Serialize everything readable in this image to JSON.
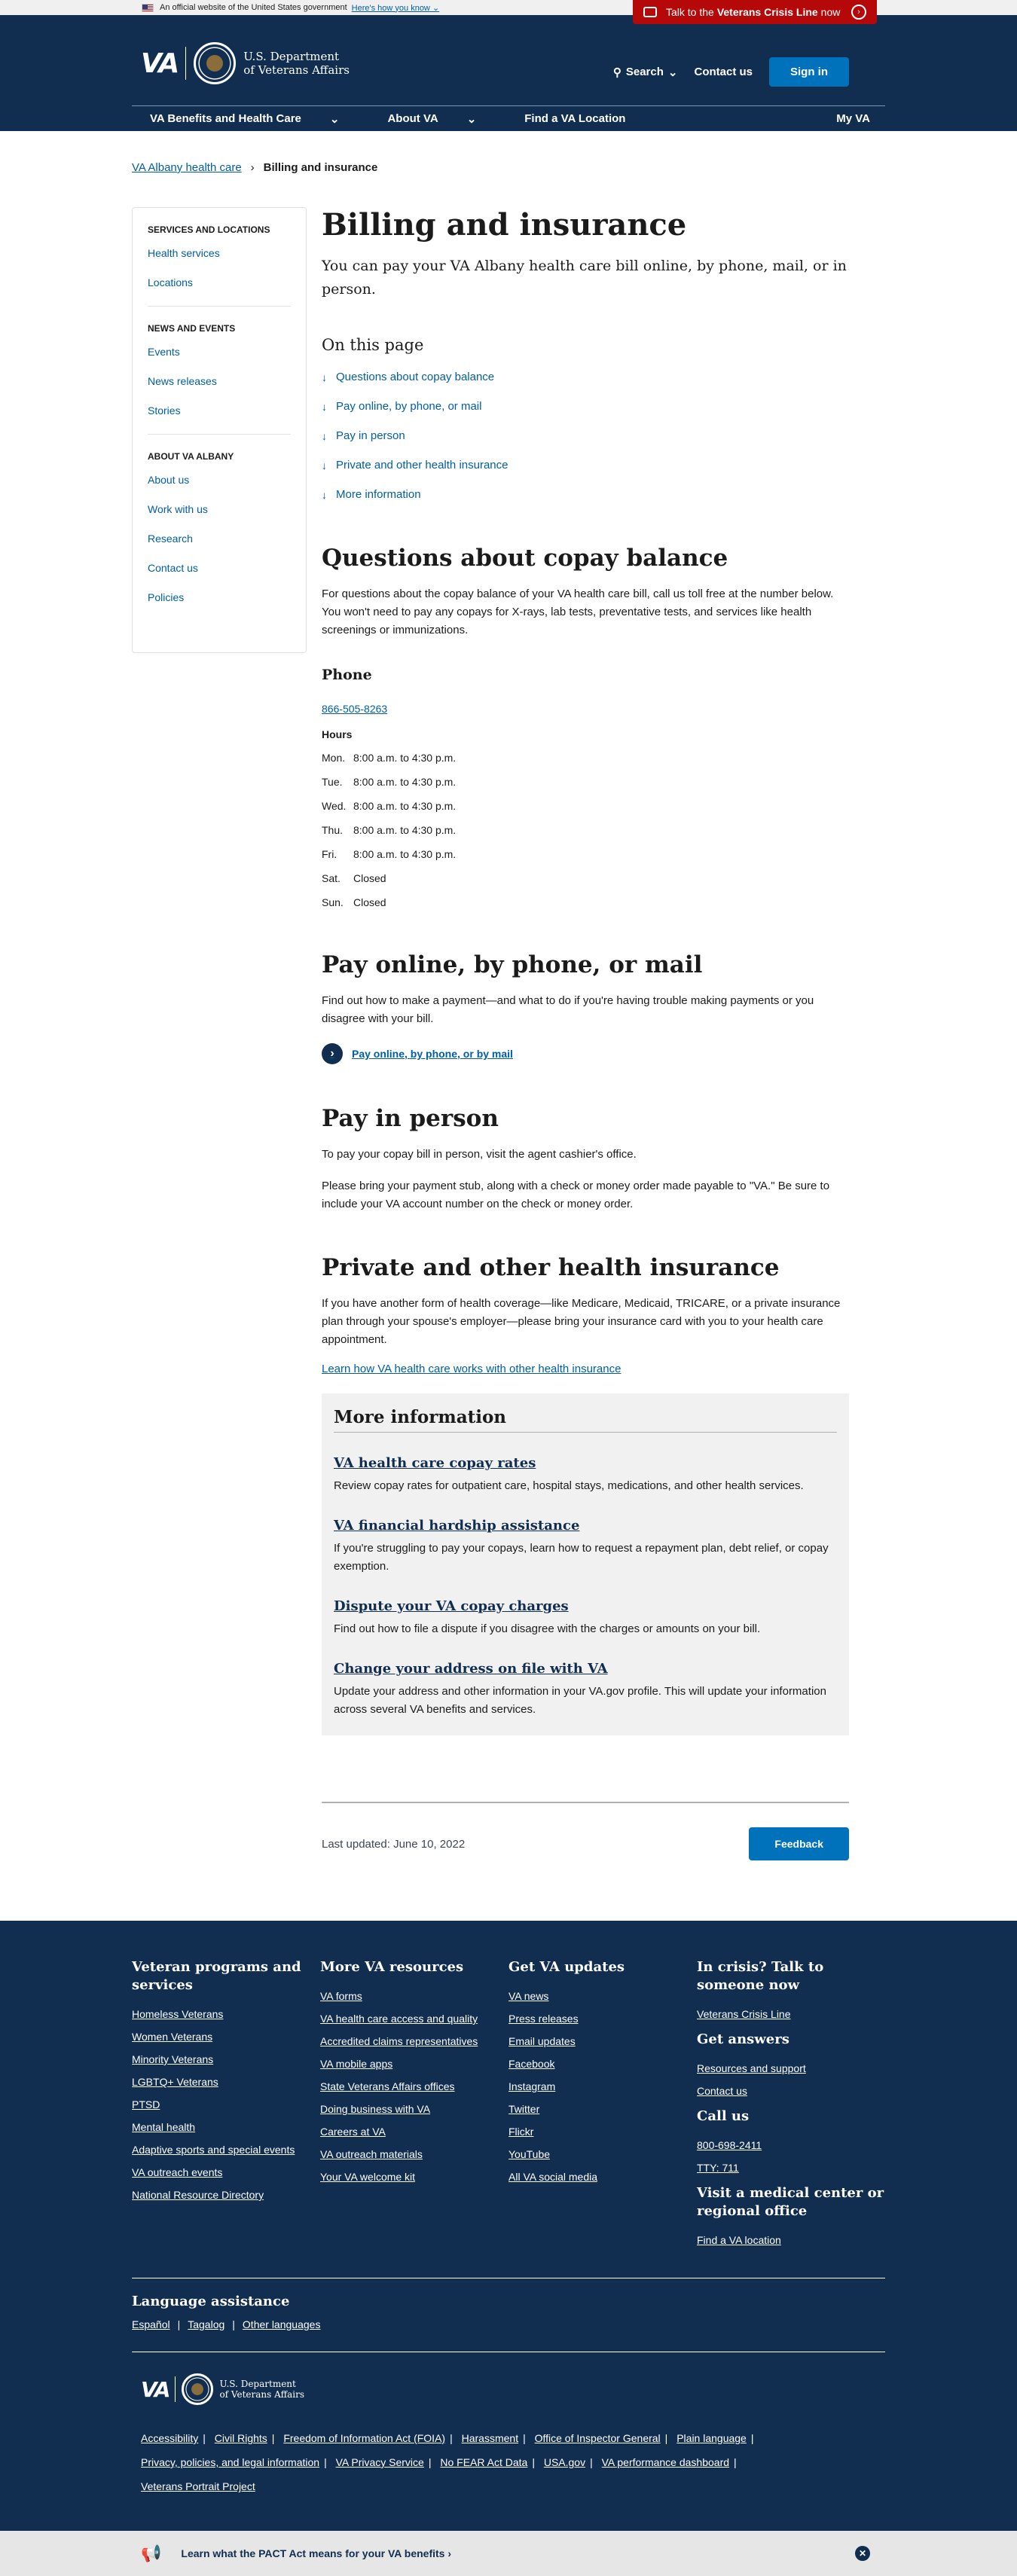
{
  "gov_banner": {
    "text": "An official website of the United States government",
    "link": "Here's how you know"
  },
  "crisis": {
    "prefix": "Talk to the",
    "bold": "Veterans Crisis Line",
    "suffix": "now"
  },
  "header": {
    "logo_text": "VA",
    "dept_line1": "U.S. Department",
    "dept_line2": "of Veterans Affairs",
    "search": "Search",
    "contact": "Contact us",
    "signin": "Sign in",
    "nav": [
      "VA Benefits and Health Care",
      "About VA",
      "Find a VA Location"
    ],
    "my_va": "My VA"
  },
  "breadcrumb": {
    "parent": "VA Albany health care",
    "current": "Billing and insurance"
  },
  "sidenav": {
    "sections": [
      {
        "title": "SERVICES AND LOCATIONS",
        "links": [
          "Health services",
          "Locations"
        ]
      },
      {
        "title": "NEWS AND EVENTS",
        "links": [
          "Events",
          "News releases",
          "Stories"
        ]
      },
      {
        "title": "ABOUT VA ALBANY",
        "links": [
          "About us",
          "Work with us",
          "Research",
          "Contact us",
          "Policies"
        ]
      }
    ]
  },
  "page": {
    "title": "Billing and insurance",
    "lede": "You can pay your VA Albany health care bill online, by phone, mail, or in person.",
    "on_this_page": "On this page",
    "toc": [
      "Questions about copay balance",
      "Pay online, by phone, or mail",
      "Pay in person",
      "Private and other health insurance",
      "More information"
    ]
  },
  "copay": {
    "title": "Questions about copay balance",
    "text": "For questions about the copay balance of your VA health care bill, call us toll free at the number below. You won't need to pay any copays for X-rays, lab tests, preventative tests, and services like health screenings or immunizations.",
    "phone_heading": "Phone",
    "phone": "866-505-8263",
    "hours_heading": "Hours",
    "hours": [
      {
        "day": "Mon.",
        "time": "8:00 a.m. to 4:30 p.m."
      },
      {
        "day": "Tue.",
        "time": "8:00 a.m. to 4:30 p.m."
      },
      {
        "day": "Wed.",
        "time": "8:00 a.m. to 4:30 p.m."
      },
      {
        "day": "Thu.",
        "time": "8:00 a.m. to 4:30 p.m."
      },
      {
        "day": "Fri.",
        "time": "8:00 a.m. to 4:30 p.m."
      },
      {
        "day": "Sat.",
        "time": "Closed"
      },
      {
        "day": "Sun.",
        "time": "Closed"
      }
    ]
  },
  "pay_online": {
    "title": "Pay online, by phone, or mail",
    "text": "Find out how to make a payment—and what to do if you're having trouble making payments or you disagree with your bill.",
    "link": "Pay online, by phone, or by mail"
  },
  "pay_person": {
    "title": "Pay in person",
    "text1": "To pay your copay bill in person, visit the agent cashier's office.",
    "text2": "Please bring your payment stub, along with a check or money order made payable to \"VA.\" Be sure to include your VA account number on the check or money order."
  },
  "insurance": {
    "title": "Private and other health insurance",
    "text": "If you have another form of health coverage—like Medicare, Medicaid, TRICARE, or a private insurance plan through your spouse's employer—please bring your insurance card with you to your health care appointment.",
    "link": "Learn how VA health care works with other health insurance"
  },
  "more_info": {
    "title": "More information",
    "items": [
      {
        "link": "VA health care copay rates",
        "text": "Review copay rates for outpatient care, hospital stays, medications, and other health services."
      },
      {
        "link": "VA financial hardship assistance",
        "text": "If you're struggling to pay your copays, learn how to request a repayment plan, debt relief, or copay exemption."
      },
      {
        "link": "Dispute your VA copay charges",
        "text": "Find out how to file a dispute if you disagree with the charges or amounts on your bill."
      },
      {
        "link": "Change your address on file with VA",
        "text": "Update your address and other information in your VA.gov profile. This will update your information across several VA benefits and services."
      }
    ]
  },
  "last_updated": "Last updated: June 10, 2022",
  "feedback": "Feedback",
  "footer": {
    "col1": {
      "title": "Veteran programs and services",
      "links": [
        "Homeless Veterans",
        "Women Veterans",
        "Minority Veterans",
        "LGBTQ+ Veterans",
        "PTSD",
        "Mental health",
        "Adaptive sports and special events",
        "VA outreach events",
        "National Resource Directory"
      ]
    },
    "col2": {
      "title": "More VA resources",
      "links": [
        "VA forms",
        "VA health care access and quality",
        "Accredited claims representatives",
        "VA mobile apps",
        "State Veterans Affairs offices",
        "Doing business with VA",
        "Careers at VA",
        "VA outreach materials",
        "Your VA welcome kit"
      ]
    },
    "col3": {
      "title": "Get VA updates",
      "links": [
        "VA news",
        "Press releases",
        "Email updates",
        "Facebook",
        "Instagram",
        "Twitter",
        "Flickr",
        "YouTube",
        "All VA social media"
      ]
    },
    "col4": {
      "crisis_title": "In crisis? Talk to someone now",
      "crisis_link": "Veterans Crisis Line",
      "answers_title": "Get answers",
      "answers_links": [
        "Resources and support",
        "Contact us"
      ],
      "call_title": "Call us",
      "call_links": [
        "800-698-2411",
        "TTY: 711"
      ],
      "visit_title": "Visit a medical center or regional office",
      "visit_link": "Find a VA location"
    },
    "language": {
      "title": "Language assistance",
      "links": [
        "Español",
        "Tagalog",
        "Other languages"
      ]
    },
    "legal": [
      "Accessibility",
      "Civil Rights",
      "Freedom of Information Act (FOIA)",
      "Harassment",
      "Office of Inspector General",
      "Plain language",
      "Privacy, policies, and legal information",
      "VA Privacy Service",
      "No FEAR Act Data",
      "USA.gov",
      "VA performance dashboard",
      "Veterans Portrait Project"
    ]
  },
  "pact_banner": "Learn what the PACT Act means for your VA benefits"
}
